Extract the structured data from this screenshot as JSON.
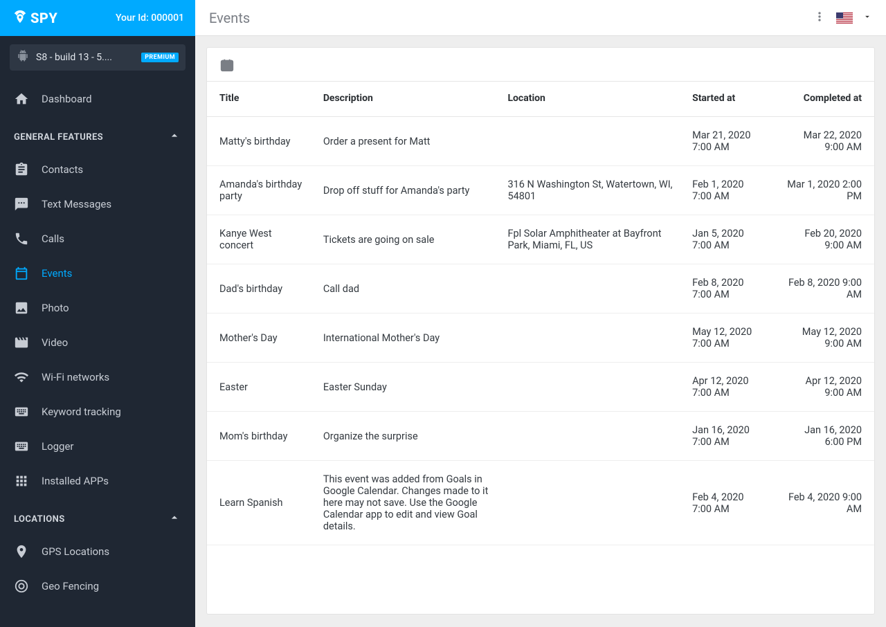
{
  "header": {
    "logo_text": "SPY",
    "your_id_label": "Your Id: 000001",
    "device_name": "S8 - build 13 - 5....",
    "premium_badge": "PREMIUM"
  },
  "titlebar": {
    "title": "Events"
  },
  "sidebar": {
    "dashboard": "Dashboard",
    "section_general": "GENERAL FEATURES",
    "section_locations": "LOCATIONS",
    "items": {
      "contacts": "Contacts",
      "text_messages": "Text Messages",
      "calls": "Calls",
      "events": "Events",
      "photo": "Photo",
      "video": "Video",
      "wifi": "Wi-Fi networks",
      "keyword": "Keyword tracking",
      "logger": "Logger",
      "installed_apps": "Installed APPs",
      "gps": "GPS Locations",
      "geofence": "Geo Fencing"
    }
  },
  "table": {
    "columns": {
      "title": "Title",
      "description": "Description",
      "location": "Location",
      "started": "Started at",
      "completed": "Completed at"
    },
    "rows": [
      {
        "title": "Matty's birthday",
        "description": "Order a present for Matt",
        "location": "",
        "started": "Mar 21, 2020 7:00 AM",
        "completed": "Mar 22, 2020 9:00 AM"
      },
      {
        "title": "Amanda's birthday party",
        "description": "Drop off stuff for Amanda's party",
        "location": "316 N Washington St, Watertown, WI, 54801",
        "started": "Feb 1, 2020 7:00 AM",
        "completed": "Mar 1, 2020 2:00 PM"
      },
      {
        "title": "Kanye West concert",
        "description": "Tickets are going on sale",
        "location": "Fpl Solar Amphitheater at Bayfront Park, Miami, FL, US",
        "started": "Jan 5, 2020 7:00 AM",
        "completed": "Feb 20, 2020 9:00 AM"
      },
      {
        "title": "Dad's birthday",
        "description": "Call dad",
        "location": "",
        "started": "Feb 8, 2020 7:00 AM",
        "completed": "Feb 8, 2020 9:00 AM"
      },
      {
        "title": "Mother's Day",
        "description": "International Mother's Day",
        "location": "",
        "started": "May 12, 2020 7:00 AM",
        "completed": "May 12, 2020 9:00 AM"
      },
      {
        "title": "Easter",
        "description": "Easter Sunday",
        "location": "",
        "started": "Apr 12, 2020 7:00 AM",
        "completed": "Apr 12, 2020 9:00 AM"
      },
      {
        "title": "Mom's birthday",
        "description": "Organize the surprise",
        "location": "",
        "started": "Jan 16, 2020 7:00 AM",
        "completed": "Jan 16, 2020 6:00 PM"
      },
      {
        "title": "Learn Spanish",
        "description": "This event was added from Goals in Google Calendar. Changes made to it here may not save. Use the Google Calendar app to edit and view Goal details.",
        "location": "",
        "started": "Feb 4, 2020 7:00 AM",
        "completed": "Feb 4, 2020 9:00 AM"
      }
    ]
  }
}
